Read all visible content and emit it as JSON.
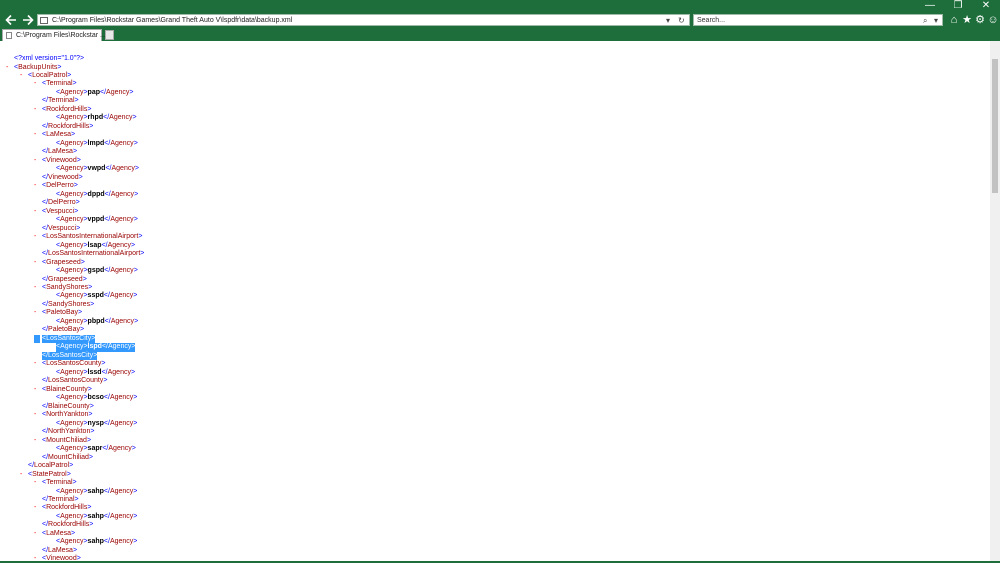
{
  "window": {
    "minimize": "—",
    "restore": "❐",
    "close": "✕"
  },
  "toolbar": {
    "back_icon": "back-arrow-icon",
    "forward_icon": "forward-arrow-icon",
    "address_value": "C:\\Program Files\\Rockstar Games\\Grand Theft Auto V\\lspdfr\\data\\backup.xml",
    "search_placeholder": "Search...",
    "home": "⌂",
    "favorites": "★",
    "settings": "⚙",
    "smiley": "☺",
    "search_btn": "⌕",
    "dropdown_btn": "▾",
    "refresh_btn": "↻"
  },
  "tab": {
    "title": "C:\\Program Files\\Rockstar ..."
  },
  "xml": {
    "declaration": "<?xml version=\"1.0\"?>",
    "lines": [
      {
        "indent": 0,
        "minus": true,
        "open": "BackupUnits"
      },
      {
        "indent": 1,
        "minus": true,
        "open": "LocalPatrol"
      },
      {
        "indent": 2,
        "minus": true,
        "open": "Terminal"
      },
      {
        "indent": 3,
        "minus": false,
        "agency": "pap"
      },
      {
        "indent": 2,
        "minus": false,
        "close": "Terminal"
      },
      {
        "indent": 2,
        "minus": true,
        "open": "RockfordHills"
      },
      {
        "indent": 3,
        "minus": false,
        "agency": "rhpd"
      },
      {
        "indent": 2,
        "minus": false,
        "close": "RockfordHills"
      },
      {
        "indent": 2,
        "minus": true,
        "open": "LaMesa"
      },
      {
        "indent": 3,
        "minus": false,
        "agency": "lmpd"
      },
      {
        "indent": 2,
        "minus": false,
        "close": "LaMesa"
      },
      {
        "indent": 2,
        "minus": true,
        "open": "Vinewood"
      },
      {
        "indent": 3,
        "minus": false,
        "agency": "vwpd"
      },
      {
        "indent": 2,
        "minus": false,
        "close": "Vinewood"
      },
      {
        "indent": 2,
        "minus": true,
        "open": "DelPerro"
      },
      {
        "indent": 3,
        "minus": false,
        "agency": "dppd"
      },
      {
        "indent": 2,
        "minus": false,
        "close": "DelPerro"
      },
      {
        "indent": 2,
        "minus": true,
        "open": "Vespucci"
      },
      {
        "indent": 3,
        "minus": false,
        "agency": "vppd"
      },
      {
        "indent": 2,
        "minus": false,
        "close": "Vespucci"
      },
      {
        "indent": 2,
        "minus": true,
        "open": "LosSantosInternationalAirport"
      },
      {
        "indent": 3,
        "minus": false,
        "agency": "lsap"
      },
      {
        "indent": 2,
        "minus": false,
        "close": "LosSantosInternationalAirport"
      },
      {
        "indent": 2,
        "minus": true,
        "open": "Grapeseed"
      },
      {
        "indent": 3,
        "minus": false,
        "agency": "gspd"
      },
      {
        "indent": 2,
        "minus": false,
        "close": "Grapeseed"
      },
      {
        "indent": 2,
        "minus": true,
        "open": "SandyShores"
      },
      {
        "indent": 3,
        "minus": false,
        "agency": "sspd"
      },
      {
        "indent": 2,
        "minus": false,
        "close": "SandyShores"
      },
      {
        "indent": 2,
        "minus": true,
        "open": "PaletoBay"
      },
      {
        "indent": 3,
        "minus": false,
        "agency": "pbpd"
      },
      {
        "indent": 2,
        "minus": false,
        "close": "PaletoBay"
      },
      {
        "indent": 2,
        "minus": true,
        "open": "LosSantosCity",
        "hl": true
      },
      {
        "indent": 3,
        "minus": false,
        "agency": "lspd",
        "hl": true
      },
      {
        "indent": 2,
        "minus": false,
        "close": "LosSantosCity",
        "hl": true
      },
      {
        "indent": 2,
        "minus": true,
        "open": "LosSantosCounty"
      },
      {
        "indent": 3,
        "minus": false,
        "agency": "lssd"
      },
      {
        "indent": 2,
        "minus": false,
        "close": "LosSantosCounty"
      },
      {
        "indent": 2,
        "minus": true,
        "open": "BlaineCounty"
      },
      {
        "indent": 3,
        "minus": false,
        "agency": "bcso"
      },
      {
        "indent": 2,
        "minus": false,
        "close": "BlaineCounty"
      },
      {
        "indent": 2,
        "minus": true,
        "open": "NorthYankton"
      },
      {
        "indent": 3,
        "minus": false,
        "agency": "nysp"
      },
      {
        "indent": 2,
        "minus": false,
        "close": "NorthYankton"
      },
      {
        "indent": 2,
        "minus": true,
        "open": "MountChiliad"
      },
      {
        "indent": 3,
        "minus": false,
        "agency": "sapr"
      },
      {
        "indent": 2,
        "minus": false,
        "close": "MountChiliad"
      },
      {
        "indent": 1,
        "minus": false,
        "close": "LocalPatrol"
      },
      {
        "indent": 1,
        "minus": true,
        "open": "StatePatrol"
      },
      {
        "indent": 2,
        "minus": true,
        "open": "Terminal"
      },
      {
        "indent": 3,
        "minus": false,
        "agency": "sahp"
      },
      {
        "indent": 2,
        "minus": false,
        "close": "Terminal"
      },
      {
        "indent": 2,
        "minus": true,
        "open": "RockfordHills"
      },
      {
        "indent": 3,
        "minus": false,
        "agency": "sahp"
      },
      {
        "indent": 2,
        "minus": false,
        "close": "RockfordHills"
      },
      {
        "indent": 2,
        "minus": true,
        "open": "LaMesa"
      },
      {
        "indent": 3,
        "minus": false,
        "agency": "sahp"
      },
      {
        "indent": 2,
        "minus": false,
        "close": "LaMesa"
      },
      {
        "indent": 2,
        "minus": true,
        "open": "Vinewood"
      }
    ]
  },
  "colors": {
    "chrome": "#1e6e3c",
    "tag": "#990000",
    "bracket": "#0000ff",
    "highlight": "#3399ff"
  }
}
